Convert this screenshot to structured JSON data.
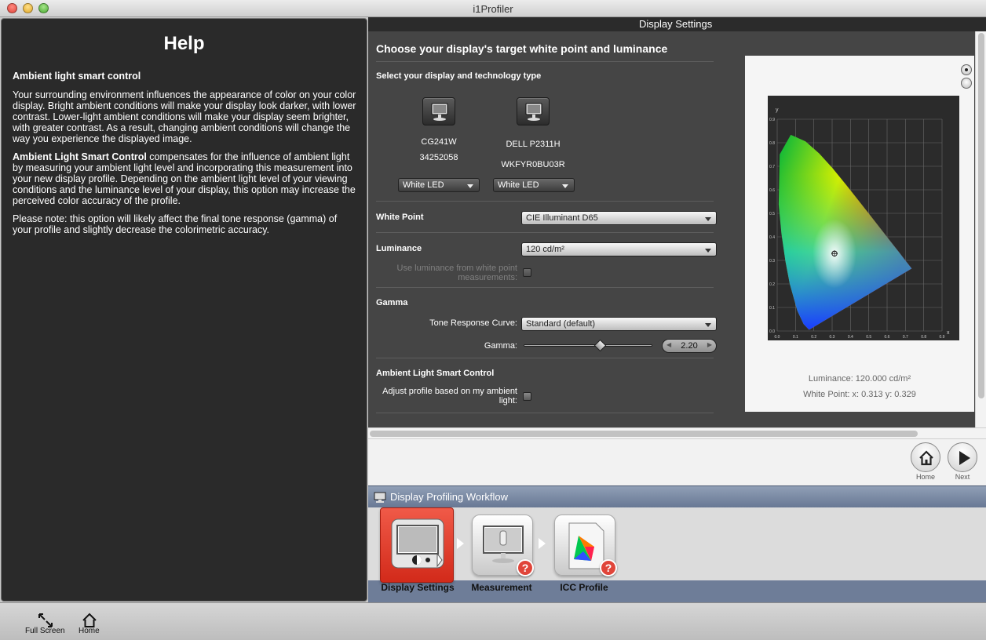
{
  "window": {
    "title": "i1Profiler"
  },
  "help": {
    "title": "Help",
    "heading": "Ambient light smart control",
    "para1": "Your surrounding environment influences the appearance of color on your color display. Bright ambient conditions will make your display look darker, with lower contrast. Lower-light ambient conditions will make your display seem brighter, with greater contrast. As a result, changing ambient conditions will change the way you experience the displayed image.",
    "para2_bold": "Ambient Light Smart Control",
    "para2": " compensates for the influence of ambient light by measuring your ambient light level and incorporating this measurement into your new display profile. Depending on the ambient light level of your viewing conditions and the luminance level of your display, this option may increase the perceived color accuracy of the profile.",
    "para3": "Please note: this option will likely affect the final tone response (gamma) of your profile and slightly decrease the colorimetric accuracy."
  },
  "settings": {
    "header": "Display Settings",
    "section_title": "Choose your display's target white point and luminance",
    "display_type_label": "Select your display and technology type",
    "displays": [
      {
        "name": "CG241W",
        "serial": "34252058",
        "tech": "White LED"
      },
      {
        "name": "DELL P2311H",
        "serial": "WKFYR0BU03R",
        "tech": "White LED"
      }
    ],
    "white_point": {
      "label": "White Point",
      "value": "CIE Illuminant D65"
    },
    "luminance": {
      "label": "Luminance",
      "value": "120 cd/m²",
      "use_wp_line1": "Use luminance from white point",
      "use_wp_line2": "measurements:"
    },
    "gamma": {
      "label": "Gamma",
      "trc_label": "Tone Response Curve:",
      "trc_value": "Standard (default)",
      "gamma_label": "Gamma:",
      "gamma_value": "2.20",
      "gamma_level": 0.6
    },
    "ambient": {
      "label": "Ambient Light Smart Control",
      "adjust_line1": "Adjust profile based on my ambient",
      "adjust_line2": "light:"
    }
  },
  "chart": {
    "luminance_text": "Luminance: 120.000 cd/m²",
    "white_point_text": "White Point: x: 0.313  y: 0.329"
  },
  "chart_data": {
    "type": "scatter",
    "title": "",
    "xlabel": "x",
    "ylabel": "y",
    "xlim": [
      0,
      0.9
    ],
    "ylim": [
      0,
      0.9
    ],
    "x_ticks": [
      "0.0",
      "0.1",
      "0.2",
      "0.3",
      "0.4",
      "0.5",
      "0.6",
      "0.7",
      "0.8",
      "0.9"
    ],
    "y_ticks": [
      "0.0",
      "0.1",
      "0.2",
      "0.3",
      "0.4",
      "0.5",
      "0.6",
      "0.7",
      "0.8",
      "0.9"
    ],
    "grid": true,
    "series": [
      {
        "values": [
          [
            0.313,
            0.329
          ]
        ]
      }
    ],
    "locus": [
      [
        0.1741,
        0.005
      ],
      [
        0.144,
        0.0297
      ],
      [
        0.1096,
        0.0868
      ],
      [
        0.0687,
        0.2007
      ],
      [
        0.0454,
        0.295
      ],
      [
        0.0235,
        0.4127
      ],
      [
        0.0082,
        0.5384
      ],
      [
        0.0139,
        0.7502
      ],
      [
        0.0743,
        0.8338
      ],
      [
        0.1547,
        0.8059
      ],
      [
        0.2296,
        0.7543
      ],
      [
        0.3016,
        0.6923
      ],
      [
        0.3731,
        0.6245
      ],
      [
        0.4441,
        0.5547
      ],
      [
        0.5125,
        0.4866
      ],
      [
        0.5752,
        0.4242
      ],
      [
        0.627,
        0.3725
      ],
      [
        0.6658,
        0.334
      ],
      [
        0.6915,
        0.3083
      ],
      [
        0.7347,
        0.2653
      ]
    ]
  },
  "nav": {
    "home_label": "Home",
    "next_label": "Next"
  },
  "workflow": {
    "title": "Display Profiling Workflow",
    "steps": [
      {
        "label": "Display Settings"
      },
      {
        "label": "Measurement",
        "badge": "?"
      },
      {
        "label": "ICC Profile",
        "badge": "?"
      }
    ]
  },
  "toolbar": {
    "fullscreen_label": "Full Screen",
    "home_label": "Home"
  }
}
